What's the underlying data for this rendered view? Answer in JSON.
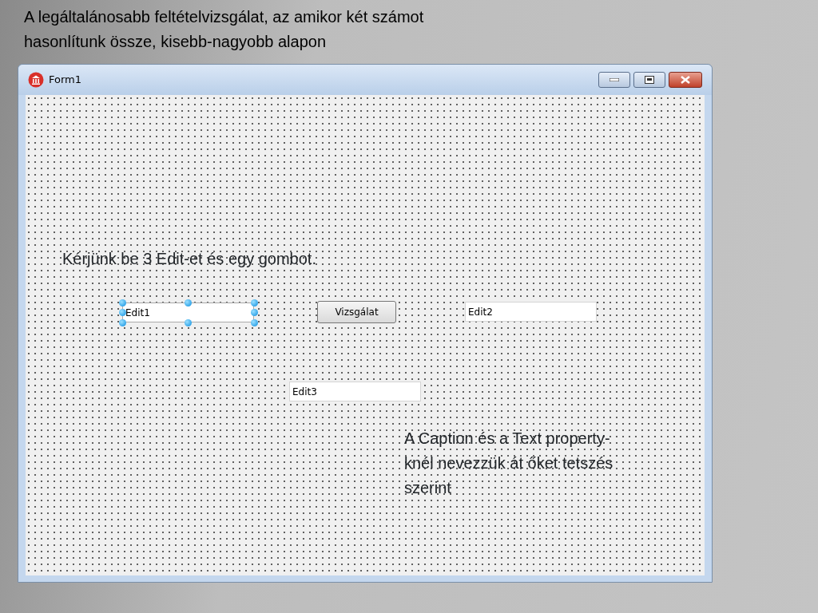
{
  "heading": "A legáltalánosabb feltételvizsgálat, az amikor két számot hasonlítunk össze, kisebb-nagyobb alapon",
  "window": {
    "title": "Form1"
  },
  "form": {
    "instruction": "Kérjünk be 3 Edit-et és egy gombot.",
    "controls": [
      {
        "kind": "edit",
        "text": "Edit1",
        "selected": true
      },
      {
        "kind": "button",
        "text": "Vizsgálat",
        "selected": false
      },
      {
        "kind": "edit",
        "text": "Edit2",
        "selected": false
      },
      {
        "kind": "edit",
        "text": "Edit3",
        "selected": false
      }
    ],
    "note": "A Caption és a Text property-knél nevezzük át őket tetszés szerint"
  }
}
